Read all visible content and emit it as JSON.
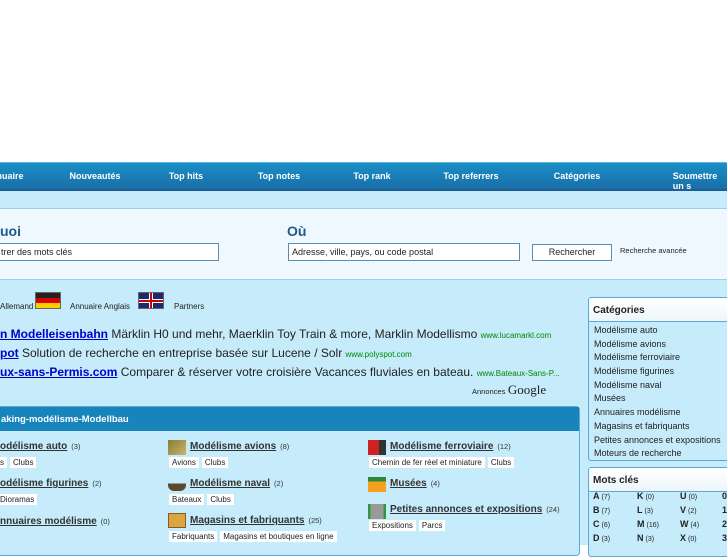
{
  "nav": [
    "nuaire",
    "Nouveautés",
    "Top hits",
    "Top notes",
    "Top rank",
    "Top referrers",
    "Catégories",
    "Soumettre un s"
  ],
  "search": {
    "what_label": "uoi",
    "what_placeholder": "trer des mots clés",
    "where_label": "Où",
    "where_placeholder": "Adresse, ville, pays, ou code postal",
    "button": "Rechercher",
    "advanced": "Recherche avancée"
  },
  "lang": {
    "german": "Allemand",
    "english": "Annuaire Anglais",
    "partners": "Partners"
  },
  "ads": [
    {
      "title": "n Modelleisenbahn",
      "text": "Märklin H0 und mehr, Maerklin Toy Train & more, Marklin Modellismo",
      "url": "www.lucamarkl.com"
    },
    {
      "title": "pot",
      "text": "Solution de recherche en entreprise basée sur Lucene / Solr",
      "url": "www.polyspot.com"
    },
    {
      "title": "ux-sans-Permis.com",
      "text": "Comparer & réserver votre croisière Vacances fluviales en bateau.",
      "url": "www.Bateaux-Sans-P..."
    }
  ],
  "ads_label": "Annonces",
  "ads_brand": "Google",
  "main": {
    "title": "aking-modélisme-Modellbau",
    "categories": [
      {
        "name": "odélisme auto",
        "count": "(3)",
        "tags": [
          "s",
          "Clubs"
        ]
      },
      {
        "name": "odélisme figurines",
        "count": "(2)",
        "tags": [
          "Dioramas"
        ]
      },
      {
        "name": "nnuaires modélisme",
        "count": "(0)",
        "tags": []
      },
      {
        "name": "Modélisme avions",
        "count": "(8)",
        "tags": [
          "Avions",
          "Clubs"
        ]
      },
      {
        "name": "Modélisme naval",
        "count": "(2)",
        "tags": [
          "Bateaux",
          "Clubs"
        ]
      },
      {
        "name": "Magasins et fabriquants",
        "count": "(25)",
        "tags": [
          "Fabriquants",
          "Magasins et boutiques en ligne"
        ]
      },
      {
        "name": "Modélisme ferroviaire",
        "count": "(12)",
        "tags": [
          "Chemin de fer réel et miniature",
          "Clubs"
        ]
      },
      {
        "name": "Musées",
        "count": "(4)",
        "tags": []
      },
      {
        "name": "Petites annonces et expositions",
        "count": "(24)",
        "tags": [
          "Expositions",
          "Parcs"
        ]
      }
    ]
  },
  "sidebar": {
    "cat_title": "Catégories",
    "cats": [
      "Modélisme auto",
      "Modélisme avions",
      "Modélisme ferroviaire",
      "Modélisme figurines",
      "Modélisme naval",
      "Musées",
      "Annuaires modélisme",
      "Magasins et fabriquants",
      "Petites annonces et expositions",
      "Moteurs de recherche"
    ],
    "kw_title": "Mots clés",
    "keywords": [
      [
        "A",
        "(7)"
      ],
      [
        "B",
        "(7)"
      ],
      [
        "C",
        "(6)"
      ],
      [
        "D",
        "(3)"
      ],
      [
        "K",
        "(0)"
      ],
      [
        "L",
        "(3)"
      ],
      [
        "M",
        "(16)"
      ],
      [
        "N",
        "(3)"
      ],
      [
        "U",
        "(0)"
      ],
      [
        "V",
        "(2)"
      ],
      [
        "W",
        "(4)"
      ],
      [
        "X",
        "(0)"
      ],
      [
        "0",
        ""
      ],
      [
        "1",
        ""
      ],
      [
        "2",
        ""
      ],
      [
        "3",
        ""
      ]
    ]
  }
}
